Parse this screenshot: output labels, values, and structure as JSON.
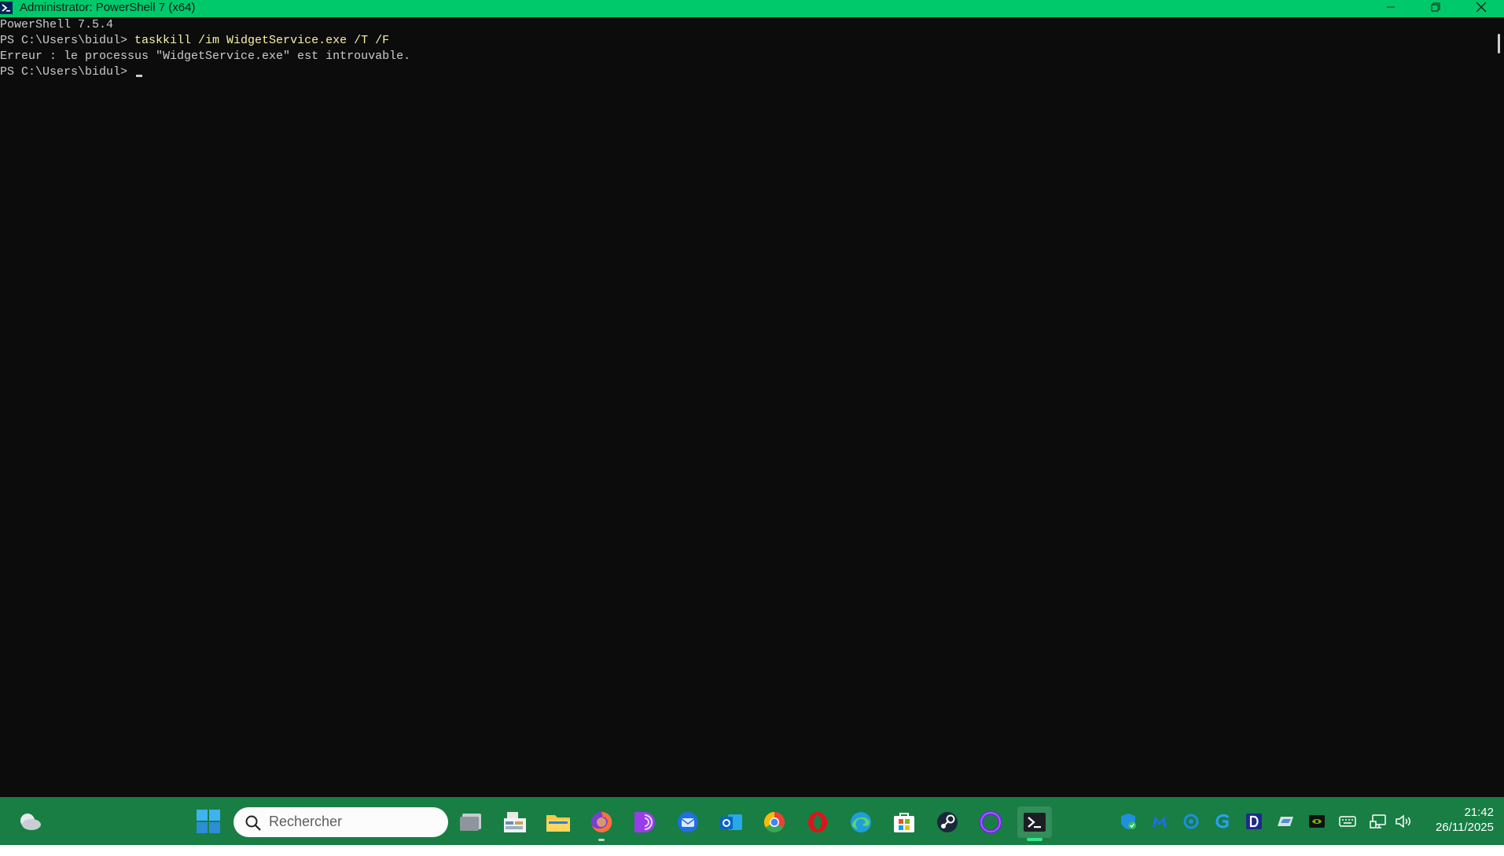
{
  "window": {
    "title": "Administrator: PowerShell 7 (x64)"
  },
  "console": {
    "version_line": "PowerShell 7.5.4",
    "prompt": "PS C:\\Users\\bidul> ",
    "command": "taskkill /im WidgetService.exe /T /F",
    "error_line": "Erreur : le processus \"WidgetService.exe\" est introuvable.",
    "prompt2": "PS C:\\Users\\bidul> "
  },
  "taskbar": {
    "search_placeholder": "Rechercher",
    "pinned_apps": [
      "task-view-icon",
      "file-manager-icon",
      "file-explorer-icon",
      "firefox-icon",
      "tor-browser-icon",
      "thunderbird-icon",
      "outlook-icon",
      "chrome-icon",
      "opera-icon",
      "edge-icon",
      "microsoft-store-icon",
      "steam-icon",
      "proton-vpn-icon",
      "powershell-icon"
    ],
    "tray_icons": [
      "windows-security-icon",
      "malwarebytes-icon",
      "cloud-sync-icon",
      "g-app-icon",
      "d-app-icon",
      "display-settings-icon",
      "nvidia-icon",
      "keyboard-icon",
      "network-icon",
      "volume-icon"
    ],
    "clock": {
      "time": "21:42",
      "date": "26/11/2025"
    }
  },
  "colors": {
    "titlebar": "#00c96b",
    "console_bg": "#0c0c0c",
    "console_text": "#cccccc",
    "command_text": "#f9f1a5",
    "taskbar": "#187e44"
  }
}
